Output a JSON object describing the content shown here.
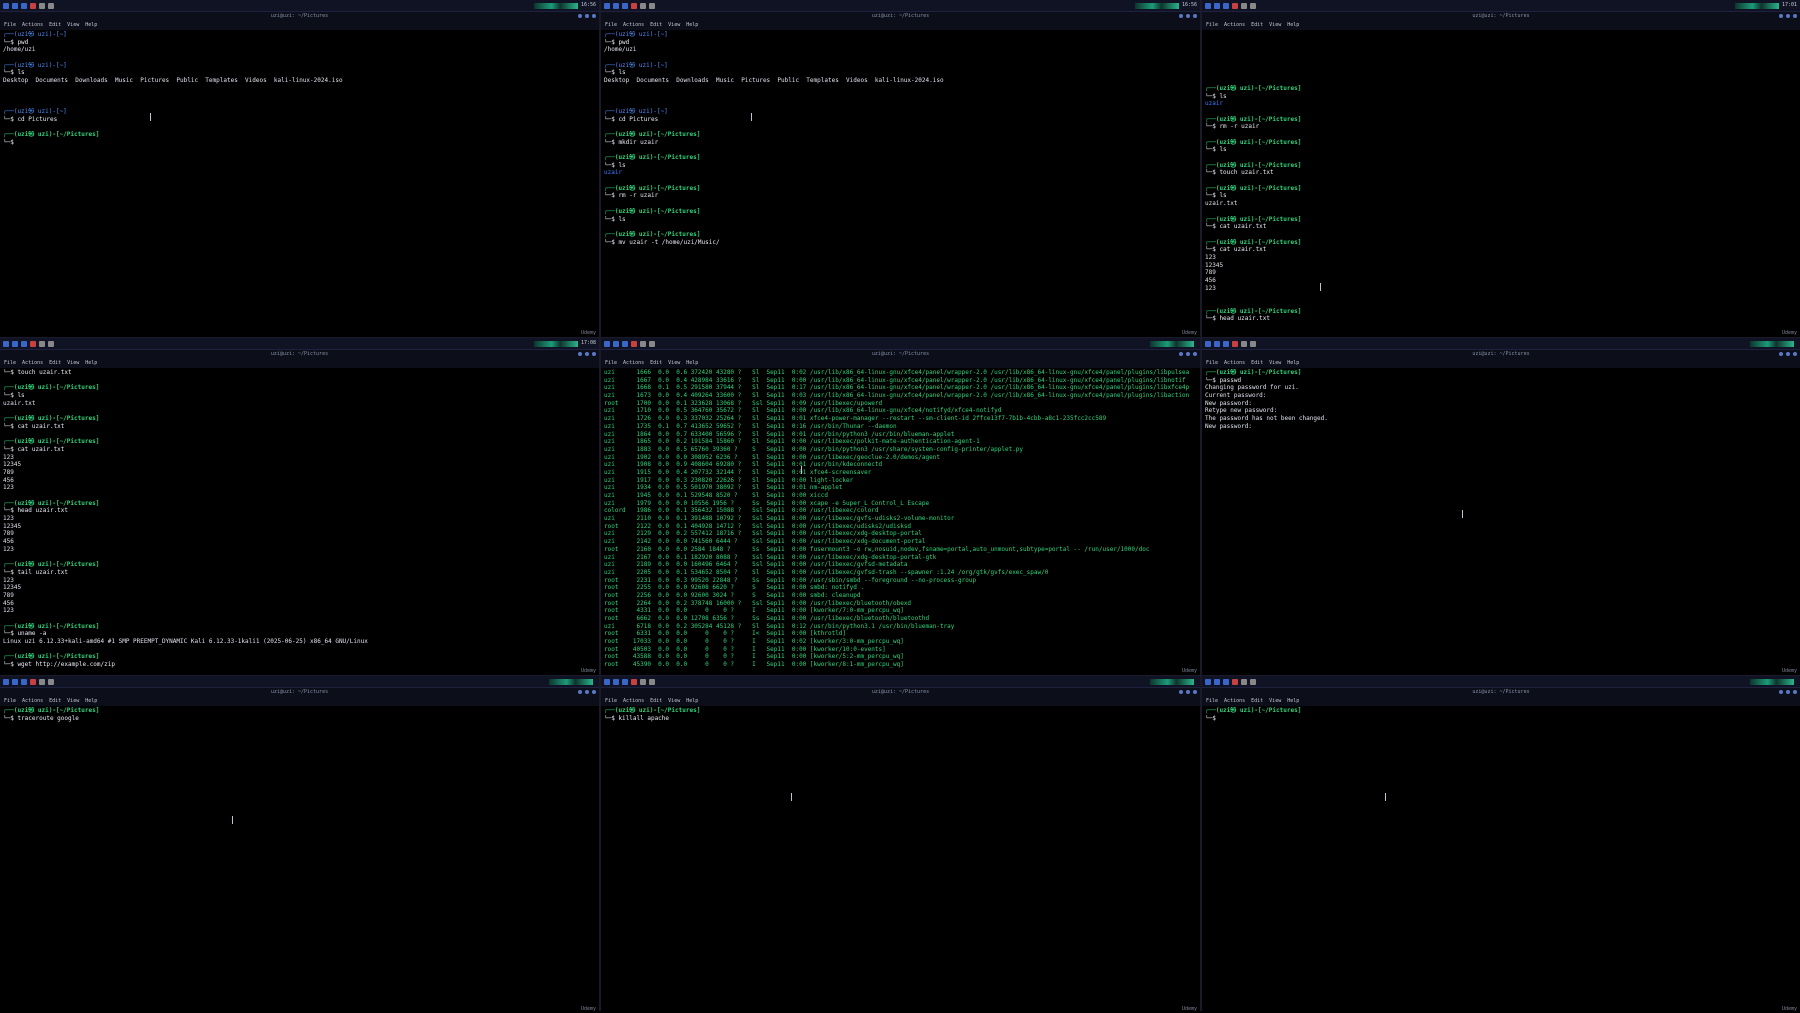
{
  "menu": [
    "File",
    "Actions",
    "Edit",
    "View",
    "Help"
  ],
  "window_title": "uzi@uzi: ~/Pictures",
  "watermark": "Udemy",
  "colors": {
    "prompt_bracket": "#4c8dff",
    "prompt_user": "#2fd47a",
    "bg": "#000000",
    "panel": "#101323"
  },
  "panes": [
    {
      "clock": "16:56",
      "lines": [
        {
          "t": "p1",
          "v": "┌──(uzi㉿ uzi)-[~]"
        },
        {
          "t": "cmd",
          "v": "└─$ pwd"
        },
        {
          "t": "out",
          "v": "/home/uzi"
        },
        {
          "t": "blank",
          "v": ""
        },
        {
          "t": "p1",
          "v": "┌──(uzi㉿ uzi)-[~]"
        },
        {
          "t": "cmd",
          "v": "└─$ ls"
        },
        {
          "t": "out",
          "v": "Desktop  Documents  Downloads  Music  Pictures  Public  Templates  Videos  kali-linux-2024.iso"
        },
        {
          "t": "blank",
          "v": ""
        },
        {
          "t": "blank",
          "v": ""
        },
        {
          "t": "blank",
          "v": ""
        },
        {
          "t": "p1",
          "v": "┌──(uzi㉿ uzi)-[~]"
        },
        {
          "t": "cmd",
          "v": "└─$ cd Pictures"
        },
        {
          "t": "blank",
          "v": ""
        },
        {
          "t": "p2",
          "v": "┌──(uzi㉿ uzi)-[~/Pictures]"
        },
        {
          "t": "cmd",
          "v": "└─$ "
        }
      ]
    },
    {
      "clock": "16:56",
      "lines": [
        {
          "t": "p1",
          "v": "┌──(uzi㉿ uzi)-[~]"
        },
        {
          "t": "cmd",
          "v": "└─$ pwd"
        },
        {
          "t": "out",
          "v": "/home/uzi"
        },
        {
          "t": "blank",
          "v": ""
        },
        {
          "t": "p1",
          "v": "┌──(uzi㉿ uzi)-[~]"
        },
        {
          "t": "cmd",
          "v": "└─$ ls"
        },
        {
          "t": "out",
          "v": "Desktop  Documents  Downloads  Music  Pictures  Public  Templates  Videos  kali-linux-2024.iso"
        },
        {
          "t": "blank",
          "v": ""
        },
        {
          "t": "blank",
          "v": ""
        },
        {
          "t": "blank",
          "v": ""
        },
        {
          "t": "p1",
          "v": "┌──(uzi㉿ uzi)-[~]"
        },
        {
          "t": "cmd",
          "v": "└─$ cd Pictures"
        },
        {
          "t": "blank",
          "v": ""
        },
        {
          "t": "p2",
          "v": "┌──(uzi㉿ uzi)-[~/Pictures]"
        },
        {
          "t": "cmd",
          "v": "└─$ mkdir uzair"
        },
        {
          "t": "blank",
          "v": ""
        },
        {
          "t": "p2",
          "v": "┌──(uzi㉿ uzi)-[~/Pictures]"
        },
        {
          "t": "cmd",
          "v": "└─$ ls"
        },
        {
          "t": "pth",
          "v": "uzair"
        },
        {
          "t": "blank",
          "v": ""
        },
        {
          "t": "p2",
          "v": "┌──(uzi㉿ uzi)-[~/Pictures]"
        },
        {
          "t": "cmd",
          "v": "└─$ rm -r uzair"
        },
        {
          "t": "blank",
          "v": ""
        },
        {
          "t": "p2",
          "v": "┌──(uzi㉿ uzi)-[~/Pictures]"
        },
        {
          "t": "cmd",
          "v": "└─$ ls"
        },
        {
          "t": "blank",
          "v": ""
        },
        {
          "t": "p2",
          "v": "┌──(uzi㉿ uzi)-[~/Pictures]"
        },
        {
          "t": "cmd",
          "v": "└─$ mv uzair -t /home/uzi/Music/"
        }
      ]
    },
    {
      "clock": "17:01",
      "lines": [
        {
          "t": "blank",
          "v": ""
        },
        {
          "t": "blank",
          "v": ""
        },
        {
          "t": "blank",
          "v": ""
        },
        {
          "t": "blank",
          "v": ""
        },
        {
          "t": "blank",
          "v": ""
        },
        {
          "t": "blank",
          "v": ""
        },
        {
          "t": "blank",
          "v": ""
        },
        {
          "t": "p2",
          "v": "┌──(uzi㉿ uzi)-[~/Pictures]"
        },
        {
          "t": "cmd",
          "v": "└─$ ls"
        },
        {
          "t": "pth",
          "v": "uzair"
        },
        {
          "t": "blank",
          "v": ""
        },
        {
          "t": "p2",
          "v": "┌──(uzi㉿ uzi)-[~/Pictures]"
        },
        {
          "t": "cmd",
          "v": "└─$ rm -r uzair"
        },
        {
          "t": "blank",
          "v": ""
        },
        {
          "t": "p2",
          "v": "┌──(uzi㉿ uzi)-[~/Pictures]"
        },
        {
          "t": "cmd",
          "v": "└─$ ls"
        },
        {
          "t": "blank",
          "v": ""
        },
        {
          "t": "p2",
          "v": "┌──(uzi㉿ uzi)-[~/Pictures]"
        },
        {
          "t": "cmd",
          "v": "└─$ touch uzair.txt"
        },
        {
          "t": "blank",
          "v": ""
        },
        {
          "t": "p2",
          "v": "┌──(uzi㉿ uzi)-[~/Pictures]"
        },
        {
          "t": "cmd",
          "v": "└─$ ls"
        },
        {
          "t": "out",
          "v": "uzair.txt"
        },
        {
          "t": "blank",
          "v": ""
        },
        {
          "t": "p2",
          "v": "┌──(uzi㉿ uzi)-[~/Pictures]"
        },
        {
          "t": "cmd",
          "v": "└─$ cat uzair.txt"
        },
        {
          "t": "blank",
          "v": ""
        },
        {
          "t": "p2",
          "v": "┌──(uzi㉿ uzi)-[~/Pictures]"
        },
        {
          "t": "cmd",
          "v": "└─$ cat uzair.txt"
        },
        {
          "t": "out",
          "v": "123"
        },
        {
          "t": "out",
          "v": "12345"
        },
        {
          "t": "out",
          "v": "789"
        },
        {
          "t": "out",
          "v": "456"
        },
        {
          "t": "out",
          "v": "123"
        },
        {
          "t": "blank",
          "v": ""
        },
        {
          "t": "blank",
          "v": ""
        },
        {
          "t": "p2",
          "v": "┌──(uzi㉿ uzi)-[~/Pictures]"
        },
        {
          "t": "cmd",
          "v": "└─$ head uzair.txt"
        }
      ]
    },
    {
      "clock": "17:08",
      "lines": [
        {
          "t": "cmd",
          "v": "└─$ touch uzair.txt"
        },
        {
          "t": "blank",
          "v": ""
        },
        {
          "t": "p2",
          "v": "┌──(uzi㉿ uzi)-[~/Pictures]"
        },
        {
          "t": "cmd",
          "v": "└─$ ls"
        },
        {
          "t": "out",
          "v": "uzair.txt"
        },
        {
          "t": "blank",
          "v": ""
        },
        {
          "t": "p2",
          "v": "┌──(uzi㉿ uzi)-[~/Pictures]"
        },
        {
          "t": "cmd",
          "v": "└─$ cat uzair.txt"
        },
        {
          "t": "blank",
          "v": ""
        },
        {
          "t": "p2",
          "v": "┌──(uzi㉿ uzi)-[~/Pictures]"
        },
        {
          "t": "cmd",
          "v": "└─$ cat uzair.txt"
        },
        {
          "t": "out",
          "v": "123"
        },
        {
          "t": "out",
          "v": "12345"
        },
        {
          "t": "out",
          "v": "789"
        },
        {
          "t": "out",
          "v": "456"
        },
        {
          "t": "out",
          "v": "123"
        },
        {
          "t": "blank",
          "v": ""
        },
        {
          "t": "p2",
          "v": "┌──(uzi㉿ uzi)-[~/Pictures]"
        },
        {
          "t": "cmd",
          "v": "└─$ head uzair.txt"
        },
        {
          "t": "out",
          "v": "123"
        },
        {
          "t": "out",
          "v": "12345"
        },
        {
          "t": "out",
          "v": "789"
        },
        {
          "t": "out",
          "v": "456"
        },
        {
          "t": "out",
          "v": "123"
        },
        {
          "t": "blank",
          "v": ""
        },
        {
          "t": "p2",
          "v": "┌──(uzi㉿ uzi)-[~/Pictures]"
        },
        {
          "t": "cmd",
          "v": "└─$ tail uzair.txt"
        },
        {
          "t": "out",
          "v": "123"
        },
        {
          "t": "out",
          "v": "12345"
        },
        {
          "t": "out",
          "v": "789"
        },
        {
          "t": "out",
          "v": "456"
        },
        {
          "t": "out",
          "v": "123"
        },
        {
          "t": "blank",
          "v": ""
        },
        {
          "t": "p2",
          "v": "┌──(uzi㉿ uzi)-[~/Pictures]"
        },
        {
          "t": "cmd",
          "v": "└─$ uname -a"
        },
        {
          "t": "out",
          "v": "Linux uzi 6.12.33+kali-amd64 #1 SMP PREEMPT_DYNAMIC Kali 6.12.33-1kali1 (2025-06-25) x86_64 GNU/Linux"
        },
        {
          "t": "blank",
          "v": ""
        },
        {
          "t": "p2",
          "v": "┌──(uzi㉿ uzi)-[~/Pictures]"
        },
        {
          "t": "cmd",
          "v": "└─$ wget http://example.com/zip"
        }
      ]
    },
    {
      "clock": "",
      "lines": [
        {
          "t": "grn",
          "v": "uzi      1666  0.0  0.6 372420 43280 ?   Sl  Sep11  0:02 /usr/lib/x86_64-linux-gnu/xfce4/panel/wrapper-2.0 /usr/lib/x86_64-linux-gnu/xfce4/panel/plugins/libpulsea"
        },
        {
          "t": "grn",
          "v": "uzi      1667  0.0  0.4 428984 33616 ?   Sl  Sep11  0:00 /usr/lib/x86_64-linux-gnu/xfce4/panel/wrapper-2.0 /usr/lib/x86_64-linux-gnu/xfce4/panel/plugins/libnotif"
        },
        {
          "t": "grn",
          "v": "uzi      1668  0.1  0.5 291580 37944 ?   Sl  Sep11  0:17 /usr/lib/x86_64-linux-gnu/xfce4/panel/wrapper-2.0 /usr/lib/x86_64-linux-gnu/xfce4/panel/plugins/libxfce4p"
        },
        {
          "t": "grn",
          "v": "uzi      1673  0.0  0.4 409264 33600 ?   Sl  Sep11  0:03 /usr/lib/x86_64-linux-gnu/xfce4/panel/wrapper-2.0 /usr/lib/x86_64-linux-gnu/xfce4/panel/plugins/libaction"
        },
        {
          "t": "grn",
          "v": "root     1700  0.0  0.1 323628 13068 ?   Ssl Sep11  0:09 /usr/libexec/upowerd"
        },
        {
          "t": "grn",
          "v": "uzi      1710  0.0  0.5 364760 35672 ?   Sl  Sep11  0:00 /usr/lib/x86_64-linux-gnu/xfce4/notifyd/xfce4-notifyd"
        },
        {
          "t": "grn",
          "v": "uzi      1726  0.0  0.3 337032 25264 ?   Sl  Sep11  0:01 xfce4-power-manager --restart --sm-client-id 2ffce13f7-7b1b-4cbb-a8c1-235fcc2cc589"
        },
        {
          "t": "grn",
          "v": "uzi      1735  0.1  0.7 413652 59652 ?   Sl  Sep11  0:16 /usr/bin/Thunar --daemon"
        },
        {
          "t": "grn",
          "v": "uzi      1864  0.0  0.7 633400 56596 ?   Sl  Sep11  0:01 /usr/bin/python3 /usr/bin/blueman-applet"
        },
        {
          "t": "grn",
          "v": "uzi      1865  0.0  0.2 191584 15860 ?   Sl  Sep11  0:00 /usr/libexec/polkit-mate-authentication-agent-1"
        },
        {
          "t": "grn",
          "v": "uzi      1883  0.0  0.5 65760 39360 ?    S   Sep11  0:00 /usr/bin/python3 /usr/share/system-config-printer/applet.py"
        },
        {
          "t": "grn",
          "v": "uzi      1902  0.0  0.0 308952 6236 ?    Sl  Sep11  0:00 /usr/libexec/geoclue-2.0/demos/agent"
        },
        {
          "t": "grn",
          "v": "uzi      1908  0.0  0.9 408604 69280 ?   Sl  Sep11  0:01 /usr/bin/kdeconnectd"
        },
        {
          "t": "grn",
          "v": "uzi      1915  0.0  0.4 207732 32144 ?   Sl  Sep11  0:01 xfce4-screensaver"
        },
        {
          "t": "grn",
          "v": "uzi      1917  0.0  0.3 230820 22626 ?   Sl  Sep11  0:00 light-locker"
        },
        {
          "t": "grn",
          "v": "uzi      1934  0.0  0.5 501970 38092 ?   Sl  Sep11  0:01 nm-applet"
        },
        {
          "t": "grn",
          "v": "uzi      1945  0.0  0.1 529548 8520 ?    Sl  Sep11  0:00 xiccd"
        },
        {
          "t": "grn",
          "v": "uzi      1979  0.0  0.0 10556 1956 ?     Ss  Sep11  0:00 xcape -e Super_L Control_L Escape"
        },
        {
          "t": "grn",
          "v": "colord   1986  0.0  0.1 356432 15088 ?   Ssl Sep11  0:00 /usr/libexec/colord"
        },
        {
          "t": "grn",
          "v": "uzi      2110  0.0  0.1 391488 10792 ?   Ssl Sep11  0:00 /usr/libexec/gvfs-udisks2-volume-monitor"
        },
        {
          "t": "grn",
          "v": "root     2122  0.0  0.1 404928 14712 ?   Ssl Sep11  0:00 /usr/libexec/udisks2/udisksd"
        },
        {
          "t": "grn",
          "v": "uzi      2129  0.0  0.2 557412 18716 ?   Ssl Sep11  0:00 /usr/libexec/xdg-desktop-portal"
        },
        {
          "t": "grn",
          "v": "uzi      2142  0.0  0.0 741560 6444 ?    Ssl Sep11  0:00 /usr/libexec/xdg-document-portal"
        },
        {
          "t": "grn",
          "v": "root     2160  0.0  0.0 2584 1848 ?      Ss  Sep11  0:00 fusermount3 -o rw,nosuid,nodev,fsname=portal,auto_unmount,subtype=portal -- /run/user/1000/doc"
        },
        {
          "t": "grn",
          "v": "uzi      2167  0.0  0.1 182920 8088 ?    Ssl Sep11  0:00 /usr/libexec/xdg-desktop-portal-gtk"
        },
        {
          "t": "grn",
          "v": "uzi      2189  0.0  0.0 160496 6464 ?    Ssl Sep11  0:00 /usr/libexec/gvfsd-metadata"
        },
        {
          "t": "grn",
          "v": "uzi      2205  0.0  0.1 534652 8504 ?    Sl  Sep11  0:00 /usr/libexec/gvfsd-trash --spawner :1.24 /org/gtk/gvfs/exec_spaw/0"
        },
        {
          "t": "grn",
          "v": "root     2231  0.0  0.3 99520 22848 ?    Ss  Sep11  0:00 /usr/sbin/smbd --foreground --no-process-group"
        },
        {
          "t": "grn",
          "v": "root     2255  0.0  0.0 92608 6620 ?     S   Sep11  0:00 smbd: notifyd ."
        },
        {
          "t": "grn",
          "v": "root     2256  0.0  0.0 92600 3024 ?     S   Sep11  0:00 smbd: cleanupd"
        },
        {
          "t": "grn",
          "v": "root     2264  0.0  0.2 378748 16000 ?   Ssl Sep11  0:00 /usr/libexec/bluetooth/obexd"
        },
        {
          "t": "grn",
          "v": "root     4331  0.0  0.0     0    0 ?     I   Sep11  0:00 [kworker/7:0-mm_percpu_wq]"
        },
        {
          "t": "grn",
          "v": "root     6662  0.0  0.0 12708 6356 ?     Ss  Sep11  0:00 /usr/libexec/bluetooth/bluetoothd"
        },
        {
          "t": "grn",
          "v": "uzi      6718  0.0  0.2 305284 45128 ?   Sl  Sep11  0:12 /usr/bin/python3.1 /usr/bin/blueman-tray"
        },
        {
          "t": "grn",
          "v": "root     6331  0.0  0.0     0    0 ?     I<  Sep11  0:00 [kthrotld]"
        },
        {
          "t": "grn",
          "v": "root    17033  0.0  0.0     0    0 ?     I   Sep11  0:02 [kworker/3:0-mm_percpu_wq]"
        },
        {
          "t": "grn",
          "v": "root    40503  0.0  0.0     0    0 ?     I   Sep11  0:00 [kworker/10:0-events]"
        },
        {
          "t": "grn",
          "v": "root    43588  0.0  0.0     0    0 ?     I   Sep11  0:00 [kworker/5:2-mm_percpu_wq]"
        },
        {
          "t": "grn",
          "v": "root    45390  0.0  0.0     0    0 ?     I   Sep11  0:00 [kworker/8:1-mm_percpu_wq]"
        }
      ]
    },
    {
      "clock": "",
      "lines": [
        {
          "t": "p2",
          "v": "┌──(uzi㉿ uzi)-[~/Pictures]"
        },
        {
          "t": "cmd",
          "v": "└─$ passwd"
        },
        {
          "t": "out",
          "v": "Changing password for uzi."
        },
        {
          "t": "out",
          "v": "Current password:"
        },
        {
          "t": "out",
          "v": "New password:"
        },
        {
          "t": "out",
          "v": "Retype new password:"
        },
        {
          "t": "out",
          "v": "The password has not been changed."
        },
        {
          "t": "out",
          "v": "New password: "
        }
      ]
    },
    {
      "clock": "",
      "lines": [
        {
          "t": "p2",
          "v": "┌──(uzi㉿ uzi)-[~/Pictures]"
        },
        {
          "t": "cmd",
          "v": "└─$ traceroute google"
        }
      ]
    },
    {
      "clock": "",
      "lines": [
        {
          "t": "p2",
          "v": "┌──(uzi㉿ uzi)-[~/Pictures]"
        },
        {
          "t": "cmd",
          "v": "└─$ killall apache"
        }
      ]
    },
    {
      "clock": "",
      "lines": [
        {
          "t": "p2",
          "v": "┌──(uzi㉿ uzi)-[~/Pictures]"
        },
        {
          "t": "cmd",
          "v": "└─$ "
        }
      ]
    }
  ]
}
